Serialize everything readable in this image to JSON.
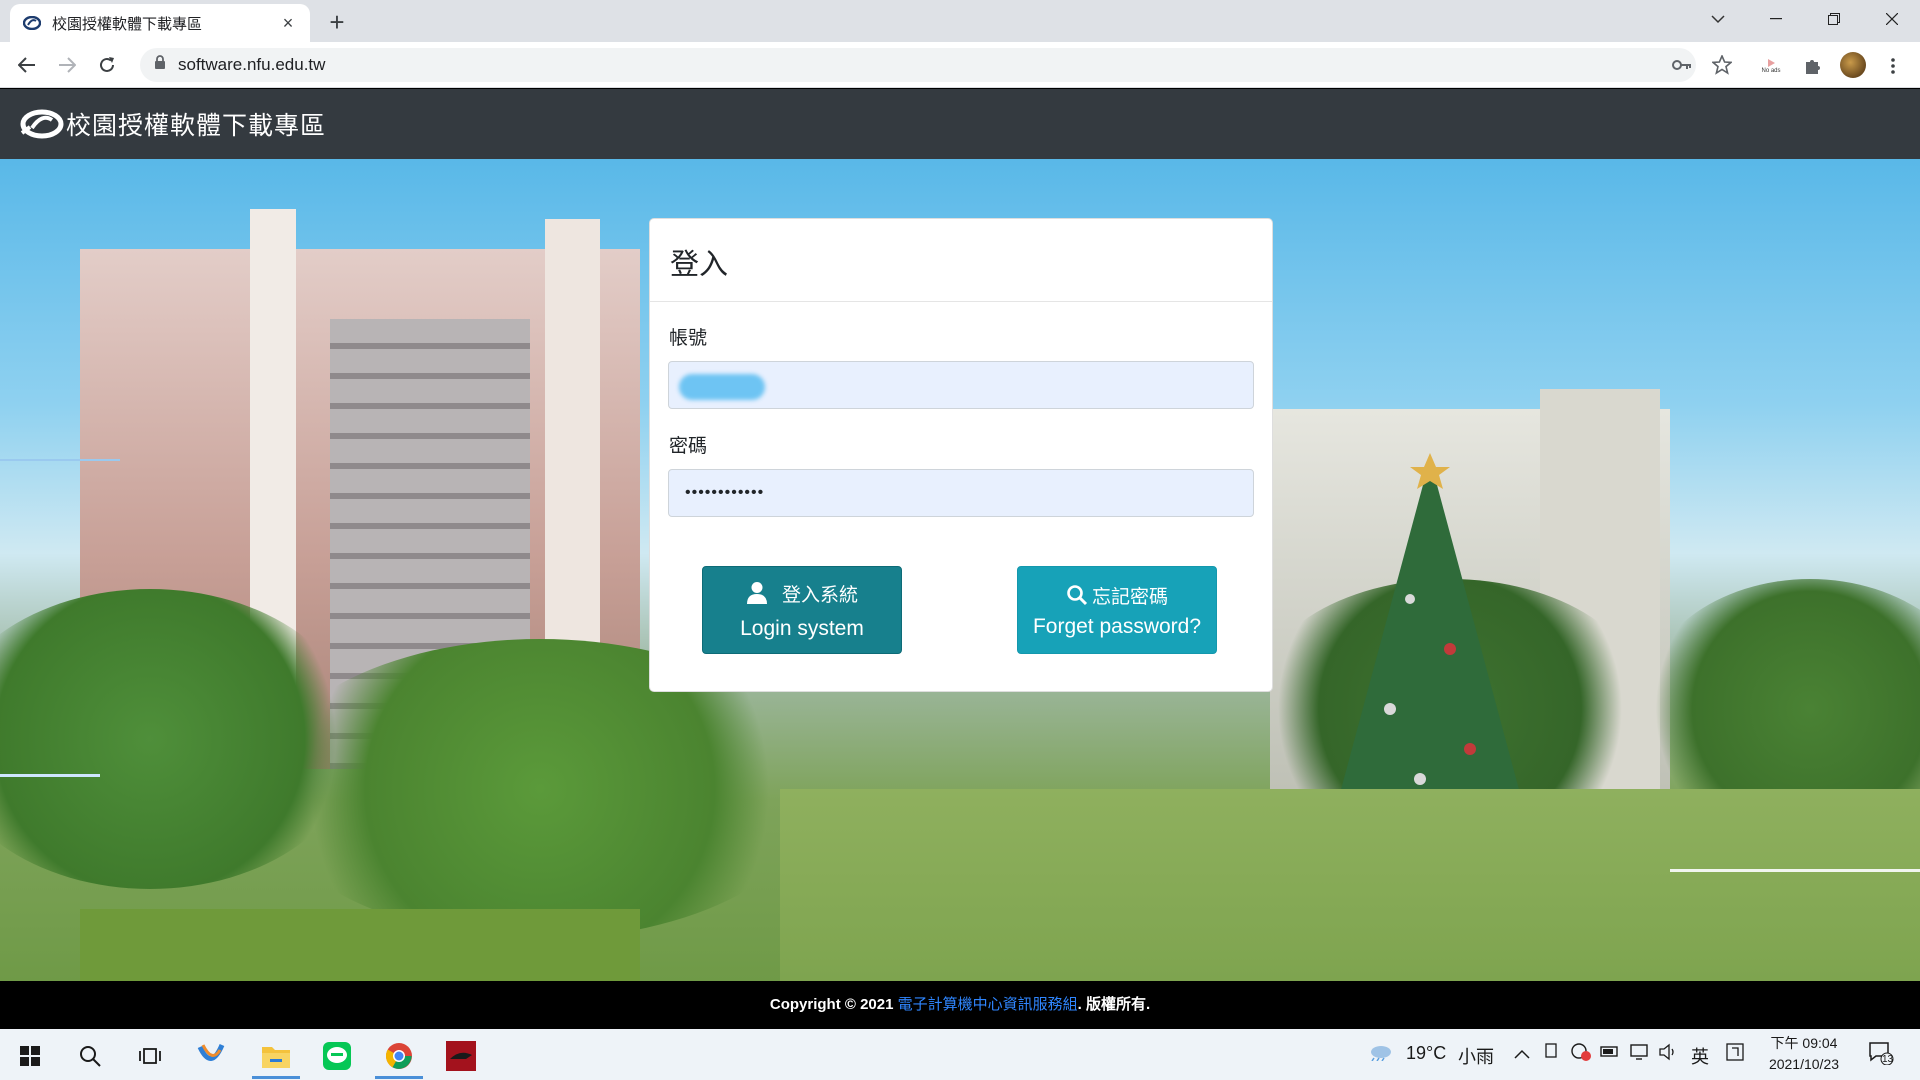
{
  "browser": {
    "tab_title": "校園授權軟體下載專區",
    "url": "software.nfu.edu.tw",
    "new_tab_symbol": "+",
    "close_tab_symbol": "×",
    "noads_label": "No ads"
  },
  "site": {
    "title": "校園授權軟體下載專區"
  },
  "login": {
    "title": "登入",
    "username_label": "帳號",
    "password_label": "密碼",
    "password_value": "••••••••••••",
    "login_button_zh": "登入系統",
    "login_button_en": "Login system",
    "forget_button_zh": "忘記密碼",
    "forget_button_en": "Forget password?"
  },
  "footer": {
    "prefix": "Copyright © 2021 ",
    "org": "電子計算機中心資訊服務組",
    "suffix": ". 版權所有."
  },
  "taskbar": {
    "weather_temp": "19°C",
    "weather_desc": "小雨",
    "ime": "英",
    "time": "下午 09:04",
    "date": "2021/10/23",
    "notification_count": "13"
  },
  "colors": {
    "header_bg": "#343a40",
    "login_button": "#17808d",
    "forget_button": "#17a2b8",
    "footer_link": "#2f86ff"
  }
}
